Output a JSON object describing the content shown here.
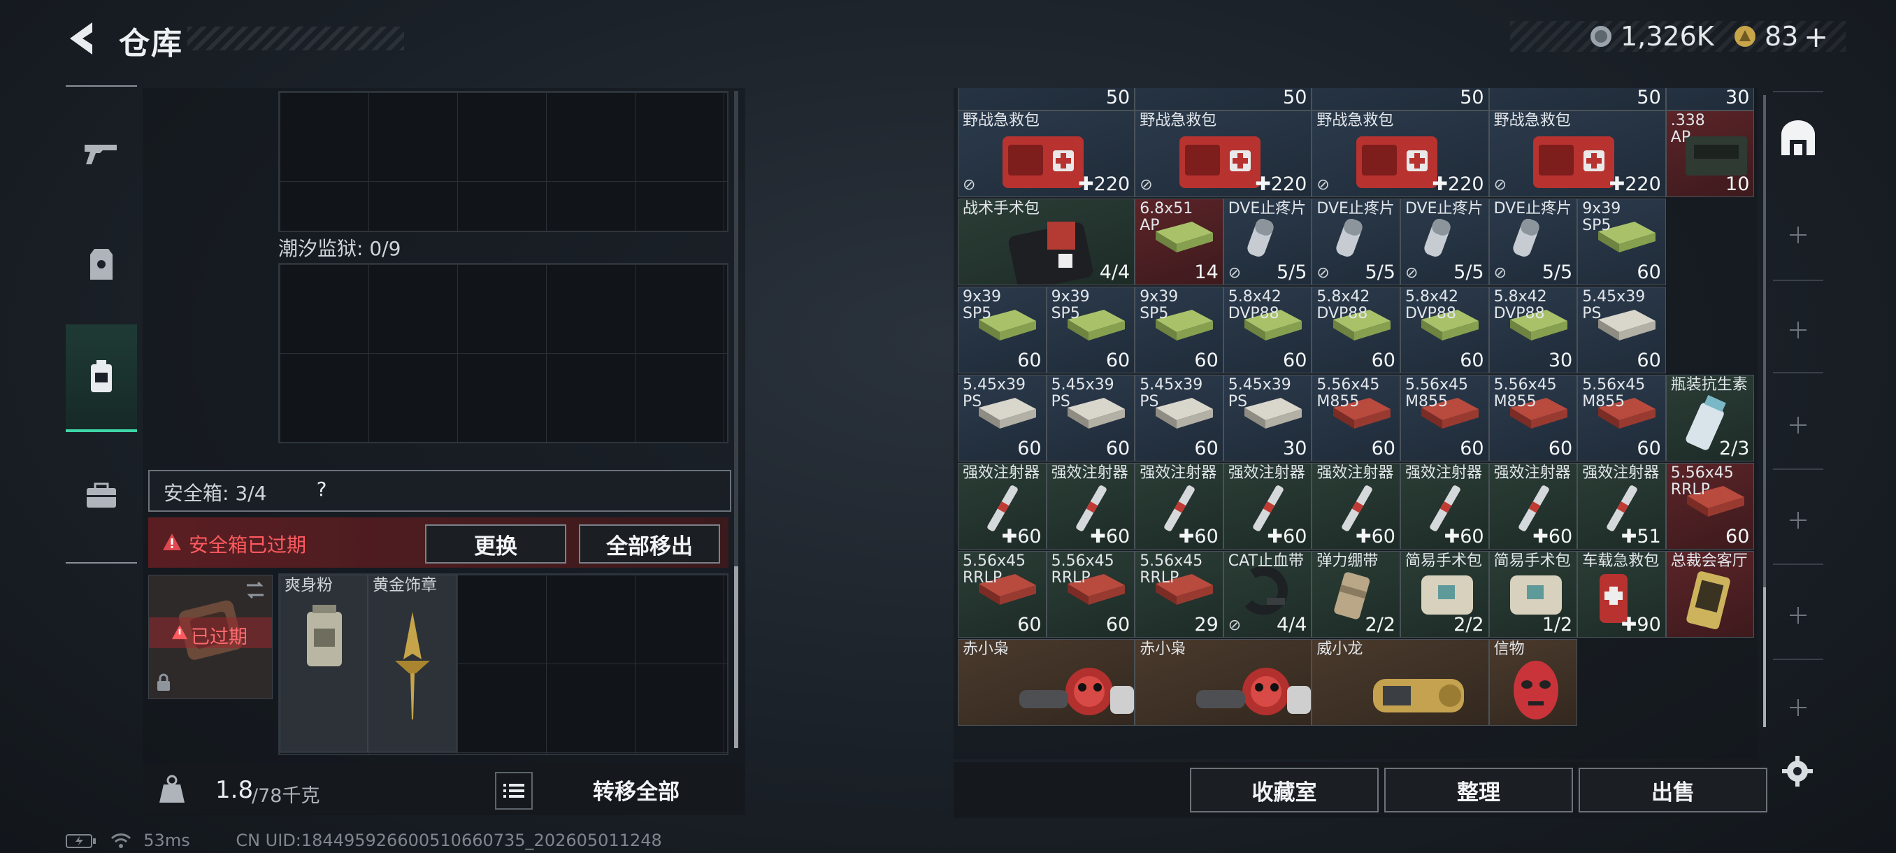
{
  "header": {
    "title": "仓库"
  },
  "currency": {
    "primary": "1,326K",
    "secondary": "83",
    "add_label": "+"
  },
  "left_panel": {
    "prison_label": "潮汐监狱: 0/9",
    "safe_box_label": "安全箱: 3/4",
    "help_label": "?",
    "expired_warning": "安全箱已过期",
    "replace_button": "更换",
    "remove_all_button": "全部移出",
    "expired_tag": "已过期",
    "items": [
      {
        "name": "爽身粉"
      },
      {
        "name": "黄金饰章"
      }
    ],
    "weight_value": "1.8",
    "weight_max": "/78千克",
    "transfer_all_button": "转移全部"
  },
  "inventory": {
    "top_row_values": [
      "50",
      "50",
      "50",
      "50",
      "30"
    ],
    "rows": [
      [
        {
          "name": "野战急救包",
          "qty": "220",
          "color": "blue",
          "art": "medkit",
          "plus": true,
          "tag": true
        },
        {
          "name": "野战急救包",
          "qty": "220",
          "color": "blue",
          "art": "medkit",
          "plus": true,
          "tag": true
        },
        {
          "name": "野战急救包",
          "qty": "220",
          "color": "blue",
          "art": "medkit",
          "plus": true,
          "tag": true
        },
        {
          "name": "野战急救包",
          "qty": "220",
          "color": "blue",
          "art": "medkit",
          "plus": true,
          "tag": true
        },
        {
          "name": ".338\nAP",
          "qty": "10",
          "color": "red",
          "art": "ammobox"
        }
      ],
      [
        {
          "name": "战术手术包",
          "qty": "4/4",
          "color": "green",
          "art": "surgkit",
          "span": 2
        },
        {
          "name": "6.8x51\nAP",
          "qty": "14",
          "color": "red",
          "art": "ammo-green"
        },
        {
          "name": "DVE止疼片",
          "qty": "5/5",
          "color": "blue",
          "art": "pill",
          "tag": true
        },
        {
          "name": "DVE止疼片",
          "qty": "5/5",
          "color": "blue",
          "art": "pill",
          "tag": true
        },
        {
          "name": "DVE止疼片",
          "qty": "5/5",
          "color": "blue",
          "art": "pill",
          "tag": true
        },
        {
          "name": "DVE止疼片",
          "qty": "5/5",
          "color": "blue",
          "art": "pill",
          "tag": true
        },
        {
          "name": "9x39\nSP5",
          "qty": "60",
          "color": "blue",
          "art": "ammo-green"
        }
      ],
      [
        {
          "name": "9x39\nSP5",
          "qty": "60",
          "color": "blue",
          "art": "ammo-green"
        },
        {
          "name": "9x39\nSP5",
          "qty": "60",
          "color": "blue",
          "art": "ammo-green"
        },
        {
          "name": "9x39\nSP5",
          "qty": "60",
          "color": "blue",
          "art": "ammo-green"
        },
        {
          "name": "5.8x42\nDVP88",
          "qty": "60",
          "color": "blue",
          "art": "ammo-green"
        },
        {
          "name": "5.8x42\nDVP88",
          "qty": "60",
          "color": "blue",
          "art": "ammo-green"
        },
        {
          "name": "5.8x42\nDVP88",
          "qty": "60",
          "color": "blue",
          "art": "ammo-green"
        },
        {
          "name": "5.8x42\nDVP88",
          "qty": "30",
          "color": "blue",
          "art": "ammo-green"
        },
        {
          "name": "5.45x39\nPS",
          "qty": "60",
          "color": "blue",
          "art": "ammo-white"
        }
      ],
      [
        {
          "name": "5.45x39\nPS",
          "qty": "60",
          "color": "blue",
          "art": "ammo-white"
        },
        {
          "name": "5.45x39\nPS",
          "qty": "60",
          "color": "blue",
          "art": "ammo-white"
        },
        {
          "name": "5.45x39\nPS",
          "qty": "60",
          "color": "blue",
          "art": "ammo-white"
        },
        {
          "name": "5.45x39\nPS",
          "qty": "30",
          "color": "blue",
          "art": "ammo-white"
        },
        {
          "name": "5.56x45\nM855",
          "qty": "60",
          "color": "blue",
          "art": "ammo-red"
        },
        {
          "name": "5.56x45\nM855",
          "qty": "60",
          "color": "blue",
          "art": "ammo-red"
        },
        {
          "name": "5.56x45\nM855",
          "qty": "60",
          "color": "blue",
          "art": "ammo-red"
        },
        {
          "name": "5.56x45\nM855",
          "qty": "60",
          "color": "blue",
          "art": "ammo-red"
        },
        {
          "name": "瓶装抗生素",
          "qty": "2/3",
          "color": "green",
          "art": "bottle"
        }
      ],
      [
        {
          "name": "强效注射器",
          "qty": "60",
          "color": "green",
          "art": "syringe",
          "plus": true
        },
        {
          "name": "强效注射器",
          "qty": "60",
          "color": "green",
          "art": "syringe",
          "plus": true
        },
        {
          "name": "强效注射器",
          "qty": "60",
          "color": "green",
          "art": "syringe",
          "plus": true
        },
        {
          "name": "强效注射器",
          "qty": "60",
          "color": "green",
          "art": "syringe",
          "plus": true
        },
        {
          "name": "强效注射器",
          "qty": "60",
          "color": "green",
          "art": "syringe",
          "plus": true
        },
        {
          "name": "强效注射器",
          "qty": "60",
          "color": "green",
          "art": "syringe",
          "plus": true
        },
        {
          "name": "强效注射器",
          "qty": "60",
          "color": "green",
          "art": "syringe",
          "plus": true
        },
        {
          "name": "强效注射器",
          "qty": "51",
          "color": "green",
          "art": "syringe",
          "plus": true
        },
        {
          "name": "5.56x45\nRRLP",
          "qty": "60",
          "color": "red",
          "art": "ammo-red"
        }
      ],
      [
        {
          "name": "5.56x45\nRRLP",
          "qty": "60",
          "color": "green",
          "art": "ammo-red"
        },
        {
          "name": "5.56x45\nRRLP",
          "qty": "60",
          "color": "green",
          "art": "ammo-red"
        },
        {
          "name": "5.56x45\nRRLP",
          "qty": "29",
          "color": "green",
          "art": "ammo-red"
        },
        {
          "name": "CAT止血带",
          "qty": "4/4",
          "color": "green",
          "art": "tourniquet",
          "tag": true
        },
        {
          "name": "弹力绷带",
          "qty": "2/2",
          "color": "green",
          "art": "bandage"
        },
        {
          "name": "简易手术包",
          "qty": "2/2",
          "color": "green",
          "art": "pouch"
        },
        {
          "name": "简易手术包",
          "qty": "1/2",
          "color": "green",
          "art": "pouch"
        },
        {
          "name": "车载急救包",
          "qty": "90",
          "color": "green",
          "art": "redbag",
          "plus": true
        },
        {
          "name": "总裁会客厅",
          "qty": "",
          "color": "red",
          "art": "card"
        }
      ],
      [
        {
          "name": "赤小枭",
          "qty": "",
          "color": "orange",
          "art": "figure",
          "span": 2
        },
        {
          "name": "赤小枭",
          "qty": "",
          "color": "orange",
          "art": "figure",
          "span": 2
        },
        {
          "name": "威小龙",
          "qty": "",
          "color": "orange",
          "art": "dragon",
          "span": 2
        },
        {
          "name": "信物",
          "qty": "",
          "color": "orange",
          "art": "mask"
        }
      ]
    ]
  },
  "bottom_buttons": {
    "collection": "收藏室",
    "sort": "整理",
    "sell": "出售"
  },
  "status_bar": {
    "ping": "53ms",
    "uid": "CN UID:1844959266005106607​35_202605011248"
  },
  "colors": {
    "accent_green": "#3ed6a6",
    "warning_red": "#e0484f",
    "panel_bg": "#15191e"
  }
}
